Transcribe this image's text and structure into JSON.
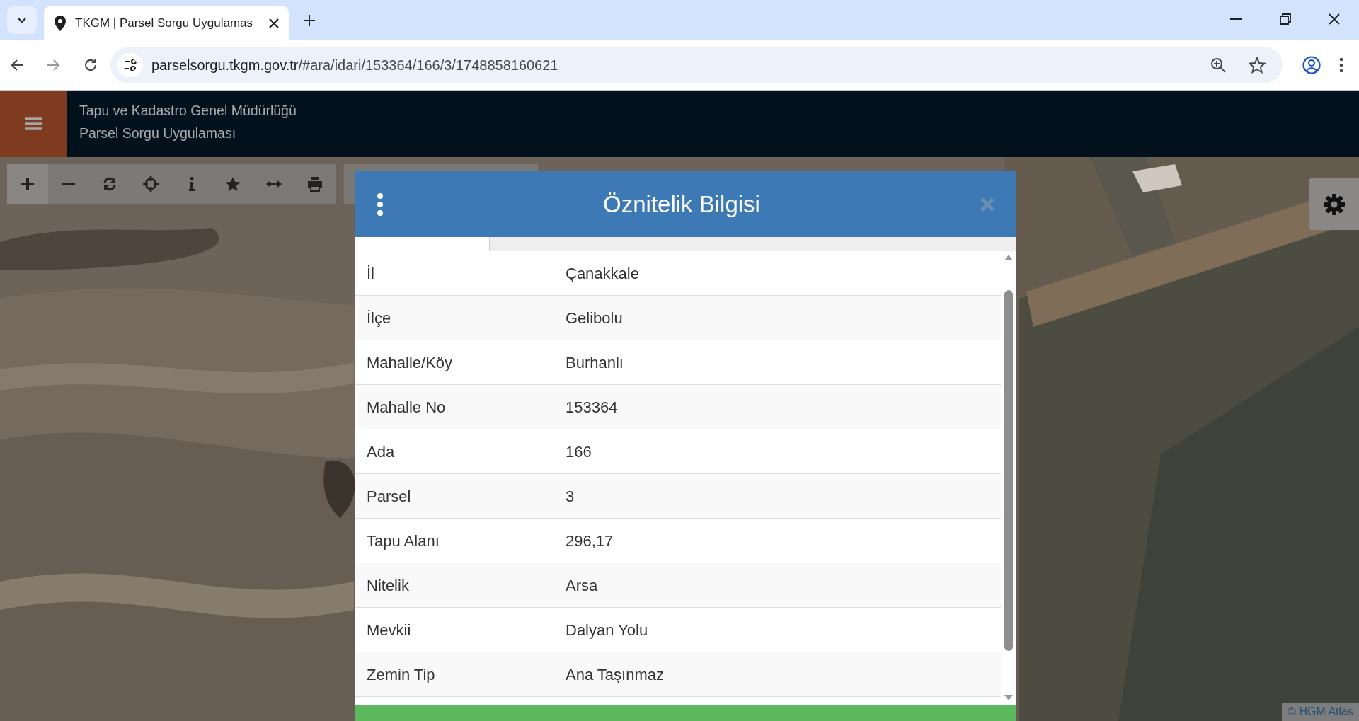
{
  "browser": {
    "tab_title": "TKGM | Parsel Sorgu Uygulamas",
    "url_domain": "parselsorgu.tkgm.gov.tr",
    "url_path": "/#ara/idari/153364/166/3/1748858160621"
  },
  "header": {
    "line_1": "Tapu ve Kadastro Genel Müdürlüğü",
    "line_2": "Parsel Sorgu Uygulaması"
  },
  "toolbar": [
    {
      "kind": "plus",
      "selected": true
    },
    {
      "kind": "minus",
      "selected": false
    },
    {
      "kind": "refresh",
      "selected": false
    },
    {
      "kind": "crosshair",
      "selected": false
    },
    {
      "kind": "info",
      "selected": false
    },
    {
      "kind": "star",
      "selected": false
    },
    {
      "kind": "arrows",
      "selected": false
    },
    {
      "kind": "print",
      "selected": false
    }
  ],
  "dialog": {
    "title": "Öznitelik Bilgisi",
    "tabs": [
      {
        "selected": true
      },
      {
        "selected": false
      }
    ],
    "rows": [
      {
        "label": "İl",
        "value": "Çanakkale"
      },
      {
        "label": "İlçe",
        "value": "Gelibolu"
      },
      {
        "label": "Mahalle/Köy",
        "value": "Burhanlı"
      },
      {
        "label": "Mahalle No",
        "value": "153364"
      },
      {
        "label": "Ada",
        "value": "166"
      },
      {
        "label": "Parsel",
        "value": "3"
      },
      {
        "label": "Tapu Alanı",
        "value": "296,17"
      },
      {
        "label": "Nitelik",
        "value": "Arsa"
      },
      {
        "label": "Mevkii",
        "value": "Dalyan Yolu"
      },
      {
        "label": "Zemin Tip",
        "value": "Ana Taşınmaz"
      }
    ]
  },
  "attribution": "© HGM Atlas"
}
